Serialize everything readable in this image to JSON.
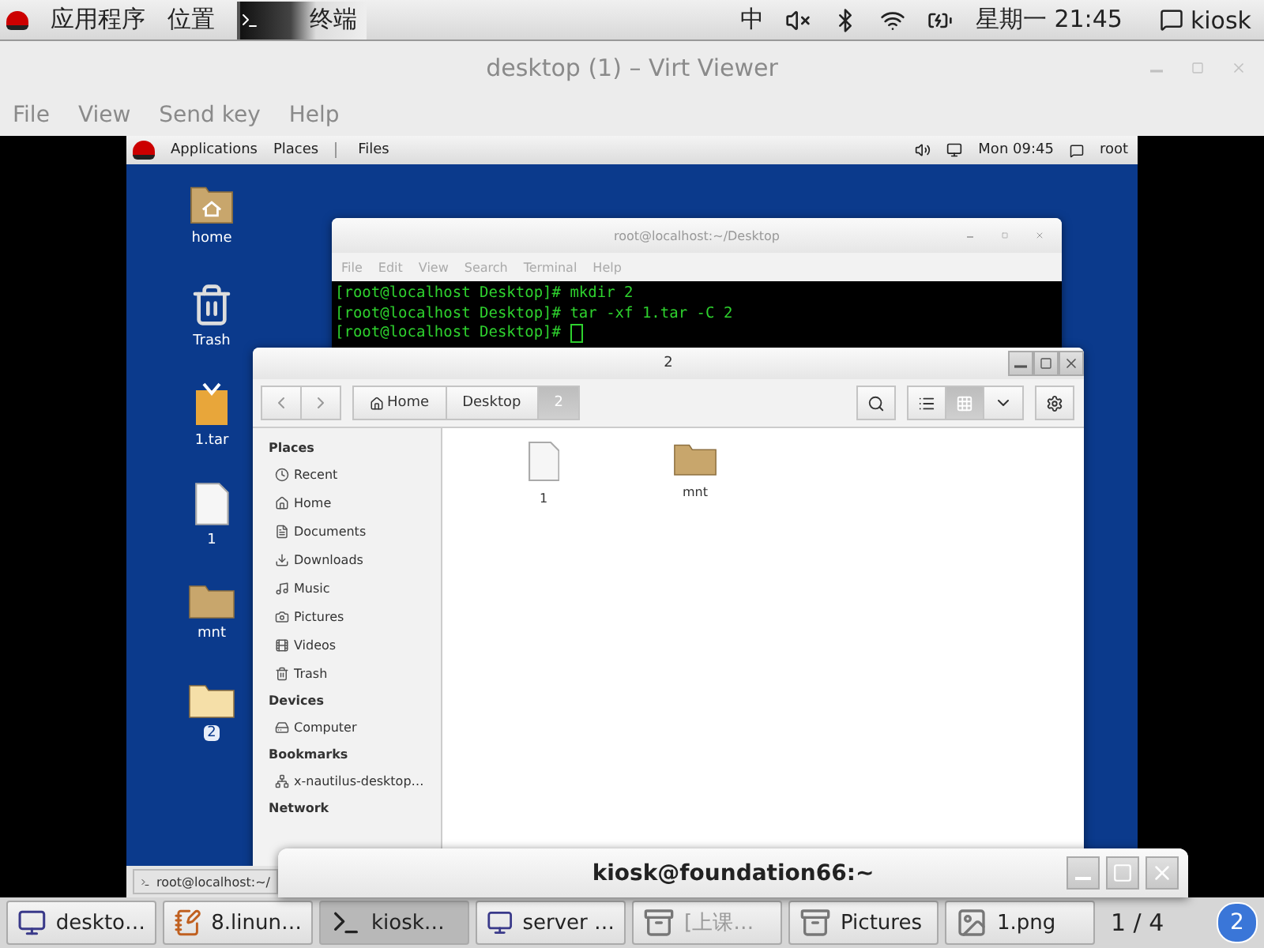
{
  "host_top_bar": {
    "menus": [
      "应用程序",
      "位置"
    ],
    "task": {
      "label": "终端"
    },
    "input_method": "中",
    "clock": "星期一 21:45",
    "user": "kiosk"
  },
  "viewer_window": {
    "title": "desktop (1) – Virt Viewer",
    "menu": [
      "File",
      "View",
      "Send key",
      "Help"
    ]
  },
  "guest": {
    "top_bar": {
      "menus": [
        "Applications",
        "Places"
      ],
      "task": "Files",
      "clock": "Mon 09:45",
      "user": "root"
    },
    "desktop_icons": [
      {
        "label": "home",
        "kind": "home",
        "selected": false
      },
      {
        "label": "Trash",
        "kind": "trash",
        "selected": false
      },
      {
        "label": "1.tar",
        "kind": "package",
        "selected": false
      },
      {
        "label": "1",
        "kind": "file",
        "selected": false
      },
      {
        "label": "mnt",
        "kind": "folder",
        "selected": false
      },
      {
        "label": "2",
        "kind": "folder",
        "selected": true
      }
    ],
    "terminal": {
      "title": "root@localhost:~/Desktop",
      "menu": [
        "File",
        "Edit",
        "View",
        "Search",
        "Terminal",
        "Help"
      ],
      "lines": [
        "[root@localhost Desktop]# mkdir 2",
        "[root@localhost Desktop]# tar -xf 1.tar -C 2",
        "[root@localhost Desktop]# "
      ],
      "cursor": true
    },
    "files": {
      "title": "2",
      "path": [
        {
          "label": "Home",
          "selected": false
        },
        {
          "label": "Desktop",
          "selected": false
        },
        {
          "label": "2",
          "selected": true
        }
      ],
      "views": [
        {
          "kind": "list",
          "selected": false
        },
        {
          "kind": "grid",
          "selected": true
        }
      ],
      "sidebar": [
        {
          "heading": "Places",
          "items": [
            {
              "label": "Recent",
              "kind": "recent"
            },
            {
              "label": "Home",
              "kind": "home"
            },
            {
              "label": "Documents",
              "kind": "documents"
            },
            {
              "label": "Downloads",
              "kind": "downloads"
            },
            {
              "label": "Music",
              "kind": "music"
            },
            {
              "label": "Pictures",
              "kind": "pictures"
            },
            {
              "label": "Videos",
              "kind": "videos"
            },
            {
              "label": "Trash",
              "kind": "trash"
            }
          ]
        },
        {
          "heading": "Devices",
          "items": [
            {
              "label": "Computer",
              "kind": "computer"
            }
          ]
        },
        {
          "heading": "Bookmarks",
          "items": [
            {
              "label": "x-nautilus-desktop…",
              "kind": "bookmark"
            }
          ]
        },
        {
          "heading": "Network"
        }
      ],
      "items": [
        {
          "label": "1",
          "kind": "file"
        },
        {
          "label": "mnt",
          "kind": "folder"
        }
      ]
    },
    "bottom_bar": {
      "task": "root@localhost:~/"
    }
  },
  "kiosk_window": {
    "title": "kiosk@foundation66:~"
  },
  "taskbar": {
    "items": [
      {
        "label": "deskto…",
        "kind": "monitor",
        "selected": false,
        "minimized": false
      },
      {
        "label": "8.linun…",
        "kind": "editor",
        "selected": false,
        "minimized": false
      },
      {
        "label": "kiosk…",
        "kind": "terminal",
        "selected": true,
        "minimized": false
      },
      {
        "label": "server …",
        "kind": "monitor",
        "selected": false,
        "minimized": false
      },
      {
        "label": "[上课…",
        "kind": "cabinet",
        "selected": false,
        "minimized": true
      },
      {
        "label": "Pictures",
        "kind": "cabinet",
        "selected": false,
        "minimized": false
      },
      {
        "label": "1.png",
        "kind": "image",
        "selected": false,
        "minimized": false
      }
    ],
    "workspace": "1 / 4",
    "notifications": "2"
  }
}
